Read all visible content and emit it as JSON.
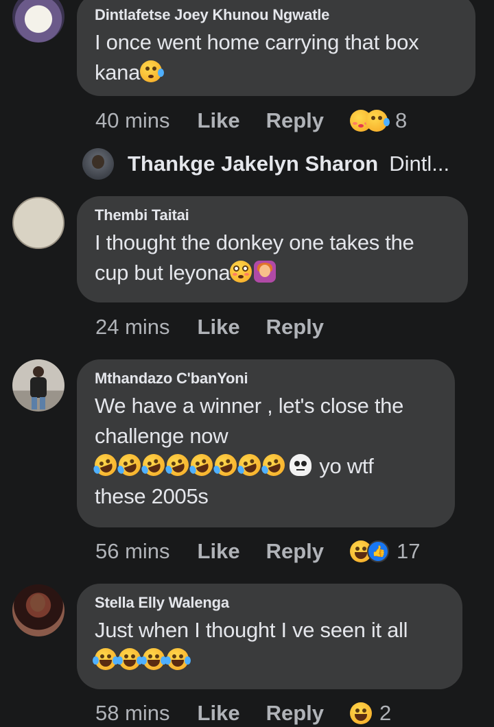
{
  "comments": [
    {
      "name": "Dintlafetse Joey Khunou Ngwatle",
      "text_line1": "I once went home carrying that box",
      "text_line2": "kana",
      "time": "40 mins",
      "like": "Like",
      "reply": "Reply",
      "reaction_count": "8"
    },
    {
      "name": "Thembi Taitai",
      "text_line1": "I thought the donkey one takes the",
      "text_line2": "cup but leyona",
      "time": "24 mins",
      "like": "Like",
      "reply": "Reply"
    },
    {
      "name": "Mthandazo C'banYoni",
      "text_line1": "We have a winner , let's close the",
      "text_line2": "challenge now",
      "text_line3_suffix": "yo wtf",
      "text_line4": "these 2005s",
      "time": "56 mins",
      "like": "Like",
      "reply": "Reply",
      "reaction_count": "17"
    },
    {
      "name": "Stella Elly Walenga",
      "text_line1": "Just when I thought I ve seen it all",
      "time": "58 mins",
      "like": "Like",
      "reply": "Reply",
      "reaction_count": "2"
    }
  ],
  "reply_preview": {
    "name": "Thankge Jakelyn Sharon",
    "snippet": "Dintl..."
  },
  "colors": {
    "background": "#18191a",
    "bubble": "#3a3b3c",
    "text": "#e4e6eb",
    "meta": "#b0b3b8"
  }
}
